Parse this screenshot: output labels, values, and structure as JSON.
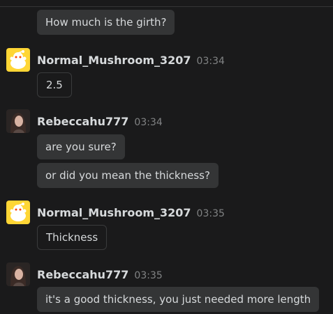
{
  "messages": [
    {
      "text": "How much is the girth?"
    },
    {
      "user": "Normal_Mushroom_3207",
      "time": "03:34",
      "avatar": "snoo-avatar-icon",
      "text": "2.5"
    },
    {
      "user": "Rebeccahu777",
      "time": "03:34",
      "avatar": "profile-photo",
      "texts": [
        "are you sure?",
        "or did you mean the thickness?"
      ]
    },
    {
      "user": "Normal_Mushroom_3207",
      "time": "03:35",
      "avatar": "snoo-avatar-icon",
      "text": "Thickness"
    },
    {
      "user": "Rebeccahu777",
      "time": "03:35",
      "avatar": "profile-photo",
      "text": "it's a good thickness, you just needed more length"
    }
  ],
  "colors": {
    "background": "#1a1a1b",
    "bubble": "#343536",
    "text": "#d7dadc",
    "timestamp": "#818384",
    "snoo_bg": "#ffd635"
  }
}
